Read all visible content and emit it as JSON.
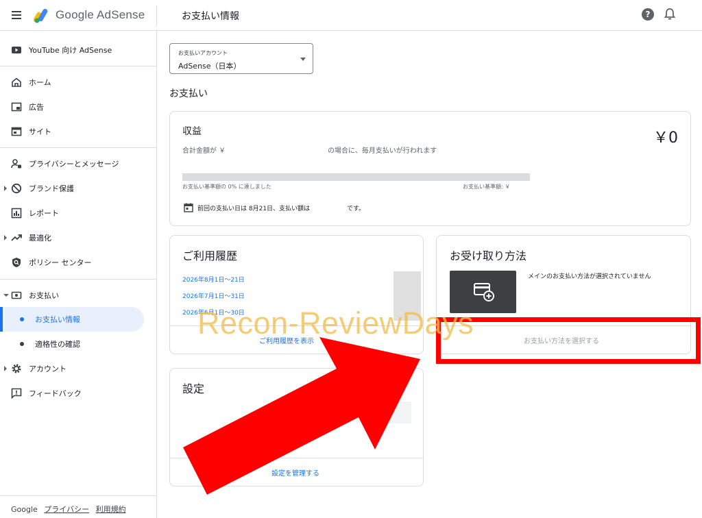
{
  "app": {
    "brand": "Google AdSense",
    "page_title": "お支払い情報"
  },
  "sidebar": {
    "youtube": "YouTube 向け AdSense",
    "items": [
      {
        "label": "ホーム"
      },
      {
        "label": "広告"
      },
      {
        "label": "サイト"
      },
      {
        "label": "プライバシーとメッセージ"
      },
      {
        "label": "ブランド保護"
      },
      {
        "label": "レポート"
      },
      {
        "label": "最適化"
      },
      {
        "label": "ポリシー センター"
      },
      {
        "label": "お支払い"
      },
      {
        "label": "お支払い情報"
      },
      {
        "label": "適格性の確認"
      },
      {
        "label": "アカウント"
      },
      {
        "label": "フィードバック"
      }
    ],
    "footer": {
      "google": "Google",
      "privacy": "プライバシー",
      "terms": "利用規約"
    }
  },
  "account_select": {
    "label": "お支払いアカウント",
    "value": "AdSense（日本）"
  },
  "section_title": "お支払い",
  "earnings": {
    "title": "収益",
    "amount": "￥0",
    "desc_a": "合計金額が ￥",
    "desc_b": "の場合に、毎月支払いが行われます",
    "progress_fraction": 0,
    "progress_left": "お支払い基準額の 0% に達しました",
    "progress_right": "お支払い基準額: ￥",
    "last_payment": "前回の支払い日は 8月21日、支払い額は",
    "last_payment_suffix": "です。"
  },
  "history": {
    "title": "ご利用履歴",
    "links": [
      "2026年8月1日〜21日",
      "2026年7月1日〜31日",
      "2026年6月1日〜30日"
    ],
    "show": "ご利用履歴を表示"
  },
  "payout": {
    "title": "お受け取り方法",
    "note": "メインのお支払い方法が選択されていません",
    "select": "お支払い方法を選択する"
  },
  "settings": {
    "title": "設定",
    "manage": "設定を管理する"
  },
  "overlay": {
    "watermark": "Recon-ReviewDays"
  },
  "colors": {
    "accent": "#1a73e8",
    "highlight": "#ff0000",
    "watermark": "#f2be50"
  }
}
